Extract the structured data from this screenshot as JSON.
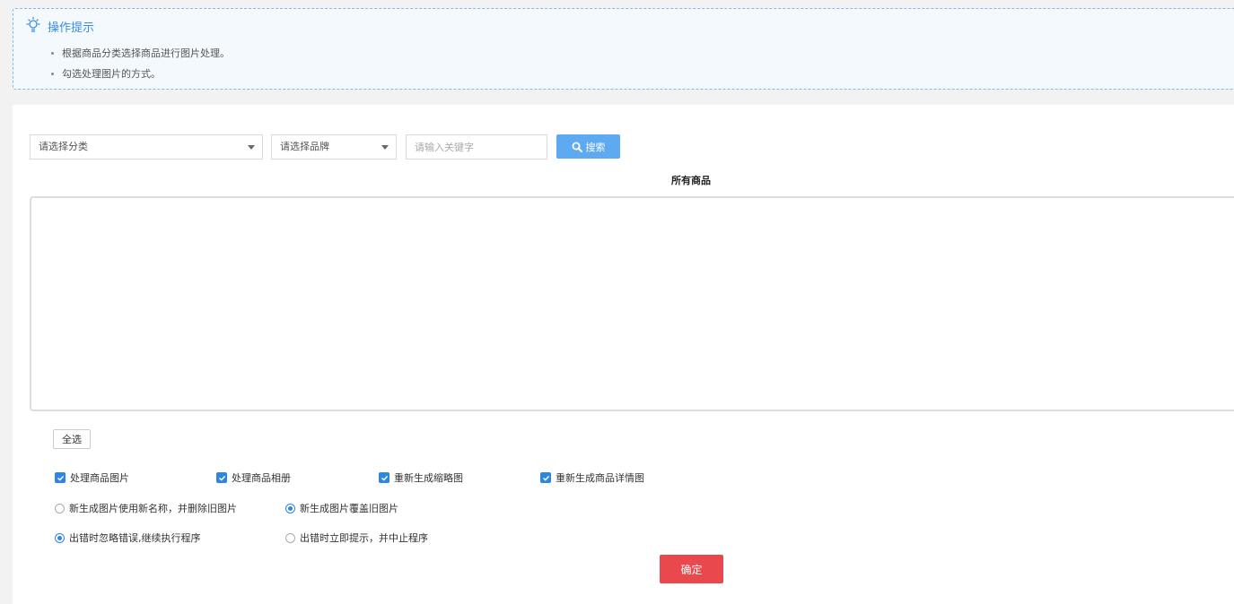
{
  "tips": {
    "title": "操作提示",
    "items": [
      "根据商品分类选择商品进行图片处理。",
      "勾选处理图片的方式。"
    ]
  },
  "filters": {
    "category_placeholder": "请选择分类",
    "brand_placeholder": "请选择品牌",
    "keyword_placeholder": "请输入关键字",
    "search_label": "搜索"
  },
  "goods": {
    "title": "所有商品",
    "select_all_label": "全选"
  },
  "process_options": [
    {
      "label": "处理商品图片",
      "checked": true
    },
    {
      "label": "处理商品相册",
      "checked": true
    },
    {
      "label": "重新生成缩略图",
      "checked": true
    },
    {
      "label": "重新生成商品详情图",
      "checked": true
    }
  ],
  "naming_options": [
    {
      "label": "新生成图片使用新名称，并删除旧图片",
      "selected": false
    },
    {
      "label": "新生成图片覆盖旧图片",
      "selected": true
    }
  ],
  "error_options": [
    {
      "label": "出错时忽略错误,继续执行程序",
      "selected": true
    },
    {
      "label": "出错时立即提示，并中止程序",
      "selected": false
    }
  ],
  "confirm_label": "确定",
  "colors": {
    "accent": "#2d86e0",
    "search": "#5eaaf0",
    "confirm": "#e9494d"
  }
}
